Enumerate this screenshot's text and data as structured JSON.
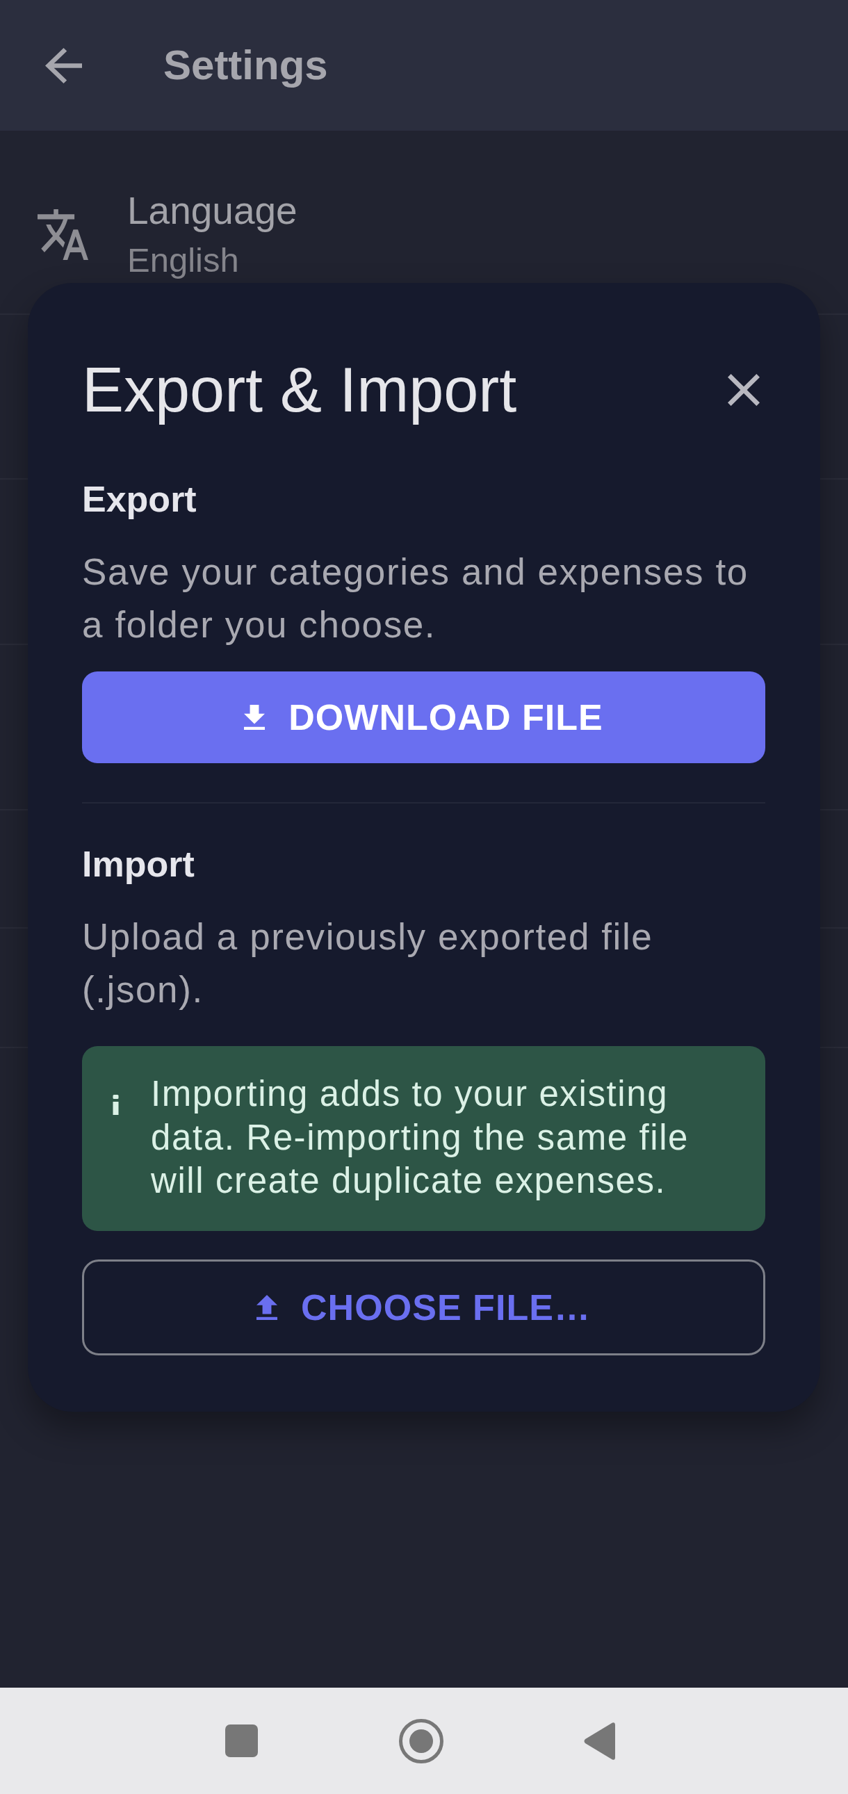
{
  "app_bar": {
    "title": "Settings"
  },
  "settings": [
    {
      "label": "Language",
      "value": "English"
    }
  ],
  "dialog": {
    "title": "Export & Import",
    "sections": [
      {
        "kind": "export",
        "heading": "Export",
        "description": "Save your categories and expenses to a folder you choose.",
        "button": "DOWNLOAD FILE"
      },
      {
        "kind": "import",
        "heading": "Import",
        "description": "Upload a previously exported file (.json).",
        "notice": "Importing adds to your existing data. Re-importing the same file will create duplicate expenses.",
        "button": "CHOOSE FILE…"
      }
    ]
  }
}
